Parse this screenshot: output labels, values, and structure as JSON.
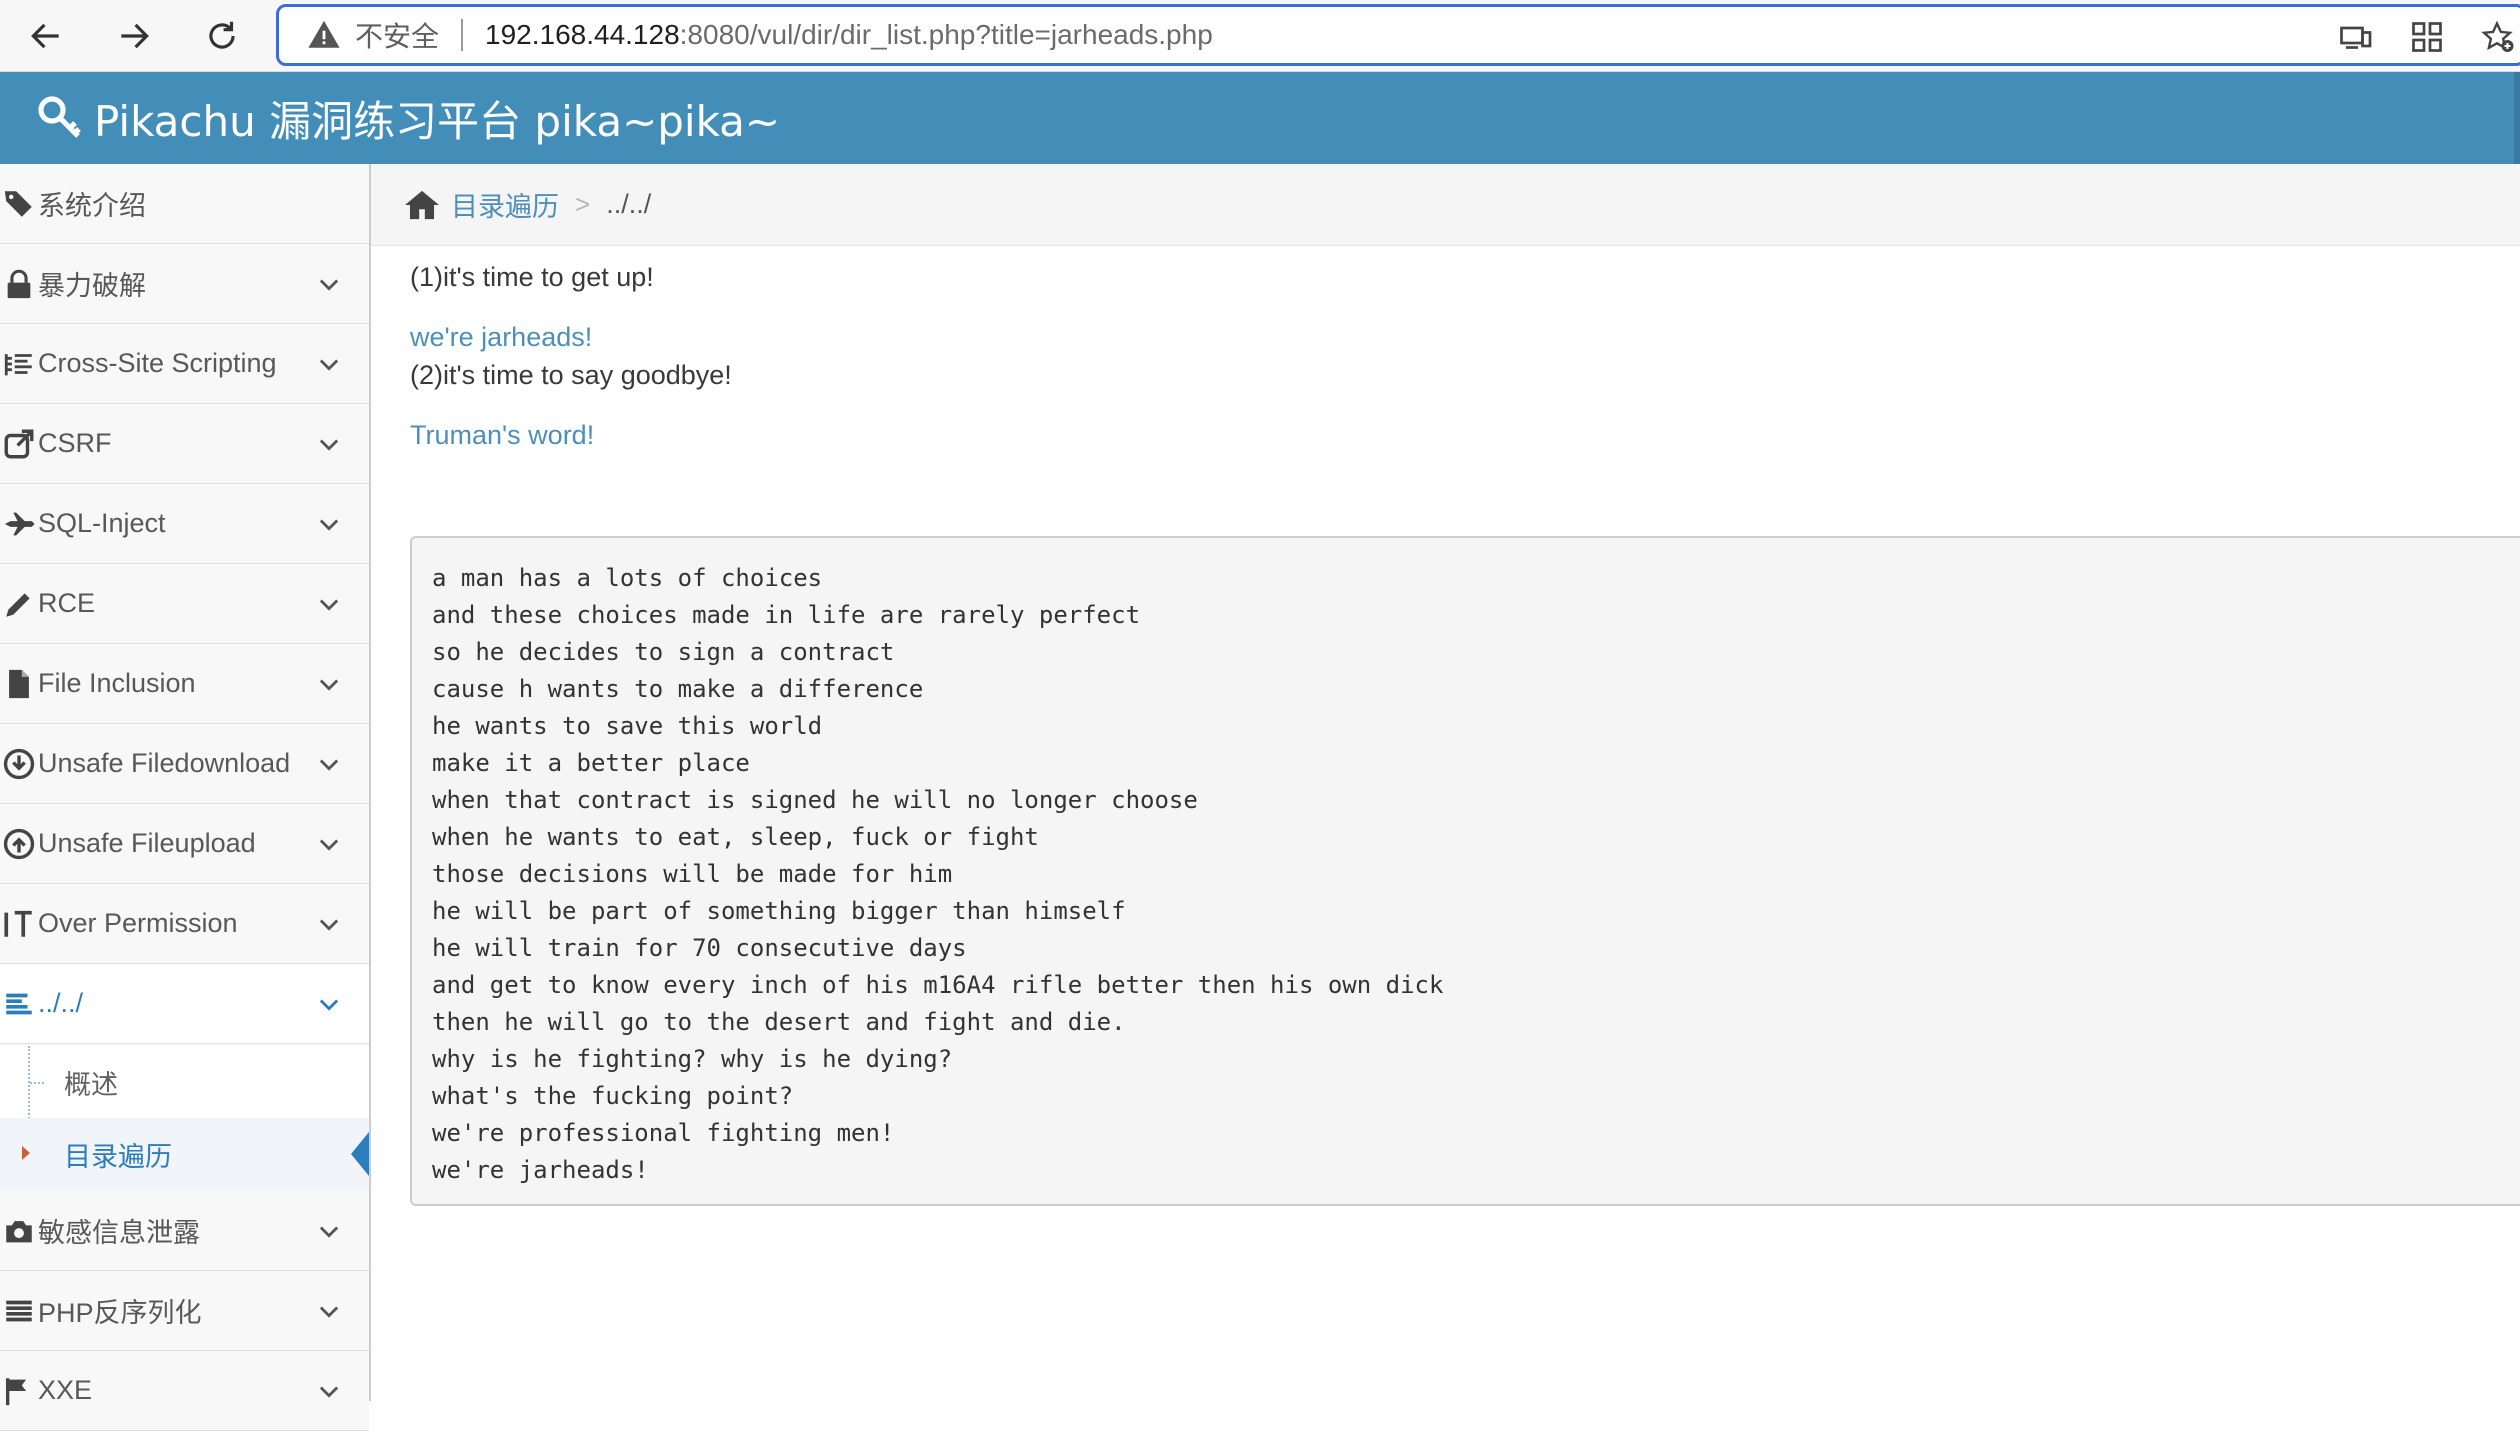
{
  "browser": {
    "insecure_label": "不安全",
    "url_host": "192.168.44.128",
    "url_rest": ":8080/vul/dir/dir_list.php?title=jarheads.php"
  },
  "header": {
    "title": "Pikachu 漏洞练习平台 pika~pika~"
  },
  "sidebar": {
    "items": [
      {
        "label": "系统介绍",
        "icon": "tags-icon"
      },
      {
        "label": "暴力破解",
        "icon": "lock-icon"
      },
      {
        "label": "Cross-Site Scripting",
        "icon": "list-indent-icon"
      },
      {
        "label": "CSRF",
        "icon": "share-icon"
      },
      {
        "label": "SQL-Inject",
        "icon": "fighter-jet-icon"
      },
      {
        "label": "RCE",
        "icon": "pencil-icon"
      },
      {
        "label": "File Inclusion",
        "icon": "file-icon"
      },
      {
        "label": "Unsafe Filedownload",
        "icon": "download-circle-icon"
      },
      {
        "label": "Unsafe Fileupload",
        "icon": "upload-circle-icon"
      },
      {
        "label": "Over Permission",
        "icon": "text-height-icon"
      },
      {
        "label": "../../",
        "icon": "align-left-icon"
      },
      {
        "label": "敏感信息泄露",
        "icon": "camera-icon"
      },
      {
        "label": "PHP反序列化",
        "icon": "align-justify-icon"
      },
      {
        "label": "XXE",
        "icon": "flag-icon"
      }
    ],
    "submenu": [
      {
        "label": "概述"
      },
      {
        "label": "目录遍历"
      }
    ]
  },
  "breadcrumb": {
    "link": "目录遍历",
    "separator": ">",
    "current": "../../"
  },
  "content": {
    "line1": "(1)it's time to get up!",
    "link1": "we're jarheads!",
    "line2": "(2)it's time to say goodbye!",
    "link2": "Truman's word!",
    "poem": [
      "a man has a lots of choices",
      "and these choices made in life are rarely perfect",
      "so he decides to sign a contract",
      "cause h wants to make a difference",
      "he wants to save this world",
      "make it a better place",
      "when that contract is signed he will no longer choose",
      "when he wants to eat, sleep, fuck or fight",
      "those decisions will be made for him",
      "he will be part of something bigger than himself",
      "he will train for 70 consecutive days",
      "and get to know every inch of his m16A4 rifle better then his own dick",
      "then he will go to the desert and fight and die.",
      "why is he fighting? why is he dying?",
      "what's the fucking point?",
      "we're professional fighting men!",
      "we're jarheads!"
    ]
  },
  "colors": {
    "header_bg": "#438eb9",
    "link": "#4c8fbd",
    "active": "#2b7dbc"
  }
}
